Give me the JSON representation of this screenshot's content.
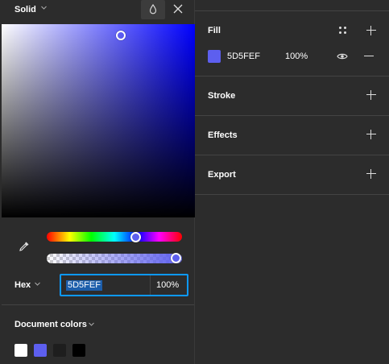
{
  "picker": {
    "fill_type": "Solid",
    "color_format": "Hex",
    "hex_value": "5D5FEF",
    "opacity": "100%",
    "hue_position": 0.66,
    "alpha_position": 1.0,
    "document_colors_label": "Document colors",
    "document_colors": [
      "#ffffff",
      "#5d5fef",
      "#1e1e1e",
      "#000000"
    ],
    "icons": [
      "chevron-down-icon",
      "drop-icon",
      "close-icon",
      "eyedropper-icon"
    ]
  },
  "panel": {
    "fill": {
      "title": "Fill",
      "hex": "5D5FEF",
      "opacity": "100%",
      "swatch_color": "#5d5fef"
    },
    "stroke": {
      "title": "Stroke"
    },
    "effects": {
      "title": "Effects"
    },
    "export": {
      "title": "Export"
    }
  },
  "colors": {
    "accent": "#0d99ff",
    "selected": "#5d5fef",
    "panel_bg": "#2c2c2c"
  }
}
